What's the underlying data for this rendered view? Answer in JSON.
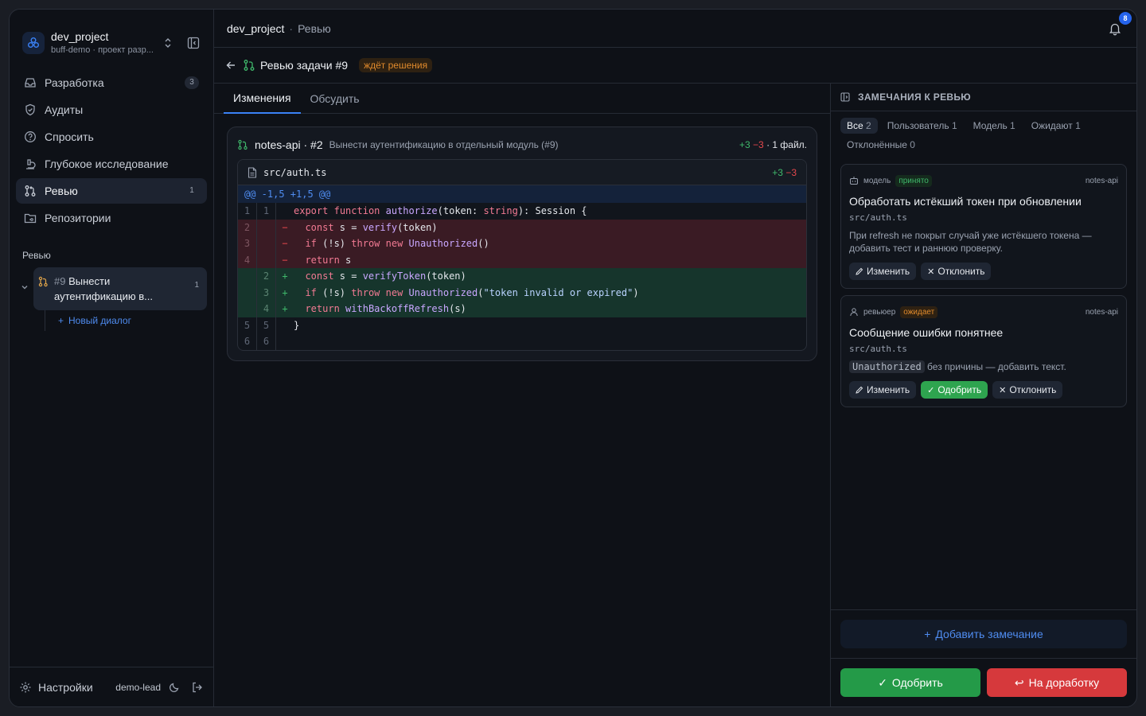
{
  "project": {
    "name": "dev_project",
    "subtitle": "buff-demo · проект разр..."
  },
  "nav": [
    {
      "label": "Разработка",
      "count": "3",
      "icon": "inbox-icon"
    },
    {
      "label": "Аудиты",
      "count": "",
      "icon": "shield-icon"
    },
    {
      "label": "Спросить",
      "count": "",
      "icon": "question-icon"
    },
    {
      "label": "Глубокое исследование",
      "count": "",
      "icon": "microscope-icon"
    },
    {
      "label": "Ревью",
      "count": "1",
      "icon": "git-pull-icon"
    },
    {
      "label": "Репозитории",
      "count": "",
      "icon": "folder-git-icon"
    }
  ],
  "sidebar_section": "Ревью",
  "tree_item": {
    "num": "#9",
    "title": "Вынести аутентификацию в...",
    "count": "1"
  },
  "new_dialog": "Новый диалог",
  "footer": {
    "settings": "Настройки",
    "user": "demo-lead"
  },
  "breadcrumb": {
    "project": "dev_project",
    "sep": "·",
    "page": "Ревью"
  },
  "notifications": "8",
  "review": {
    "title": "Ревью задачи #9",
    "status": "ждёт решения"
  },
  "tabs": [
    "Изменения",
    "Обсудить"
  ],
  "pr": {
    "repo": "notes-api · #2",
    "desc": "Вынести аутентификацию в отдельный модуль (#9)",
    "plus": "+3",
    "minus": "−3",
    "files": " · 1 файл.",
    "file": "src/auth.ts",
    "file_plus": "+3",
    "file_minus": "−3",
    "hunk": "@@ -1,5 +1,5 @@"
  },
  "panel": {
    "title": "ЗАМЕЧАНИЯ К РЕВЬЮ",
    "filters": [
      {
        "label": "Все",
        "count": "2"
      },
      {
        "label": "Пользователь",
        "count": "1"
      },
      {
        "label": "Модель",
        "count": "1"
      },
      {
        "label": "Ожидают",
        "count": "1"
      },
      {
        "label": "Отклонённые",
        "count": "0"
      }
    ],
    "comments": [
      {
        "author": "модель",
        "tag": "принято",
        "repo": "notes-api",
        "title": "Обработать истёкший токен при обновлении",
        "file": "src/auth.ts",
        "body": "При refresh не покрыт случай уже истёкшего токена — добавить тест и раннюю проверку.",
        "edit": "Изменить",
        "reject": "Отклонить"
      },
      {
        "author": "ревьюер",
        "tag": "ожидает",
        "repo": "notes-api",
        "title": "Сообщение ошибки понятнее",
        "file": "src/auth.ts",
        "code": "Unauthorized",
        "body": "без причины — добавить текст.",
        "edit": "Изменить",
        "approve": "Одобрить",
        "reject": "Отклонить"
      }
    ],
    "add_comment": "Добавить замечание",
    "approve": "Одобрить",
    "rework": "На доработку"
  }
}
